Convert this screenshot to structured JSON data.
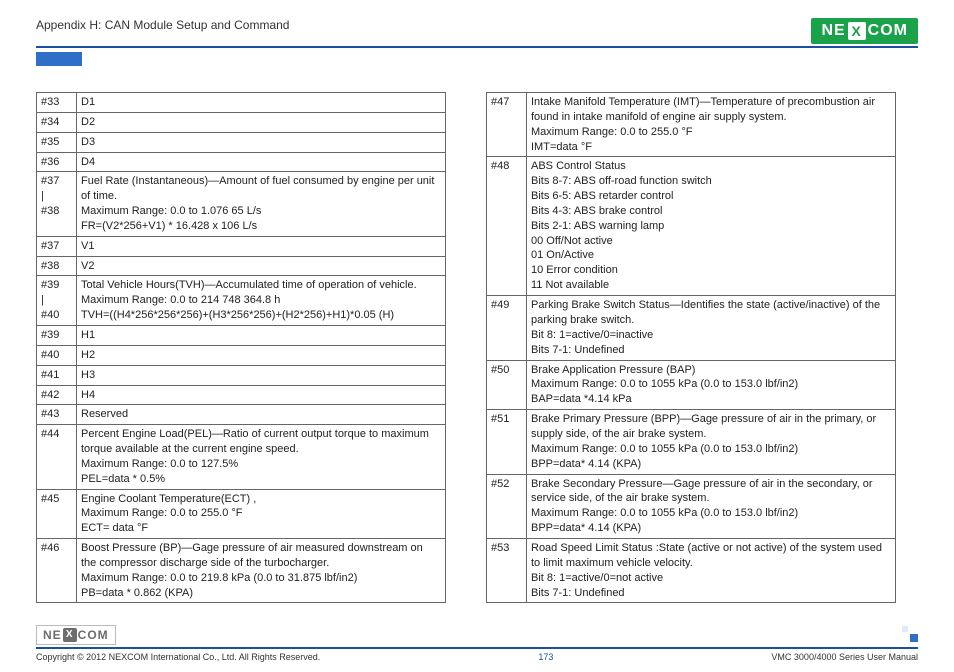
{
  "header": {
    "appendix": "Appendix H: CAN Module Setup and Command",
    "logo_left": "NE",
    "logo_x": "X",
    "logo_right": "COM"
  },
  "left_rows": [
    {
      "idx": "#33",
      "val": "D1"
    },
    {
      "idx": "#34",
      "val": "D2"
    },
    {
      "idx": "#35",
      "val": "D3"
    },
    {
      "idx": "#36",
      "val": "D4"
    },
    {
      "idx": "#37\n|\n#38",
      "val": "Fuel Rate (Instantaneous)—Amount of fuel consumed by engine per unit of time.\nMaximum Range: 0.0 to 1.076 65 L/s\nFR=(V2*256+V1) * 16.428 x 106 L/s"
    },
    {
      "idx": "#37",
      "val": "V1"
    },
    {
      "idx": "#38",
      "val": "V2"
    },
    {
      "idx": "#39\n|\n#40",
      "val": "Total Vehicle Hours(TVH)—Accumulated time of operation of vehicle.\nMaximum Range: 0.0 to 214 748 364.8 h\nTVH=((H4*256*256*256)+(H3*256*256)+(H2*256)+H1)*0.05 (H)"
    },
    {
      "idx": "#39",
      "val": "H1"
    },
    {
      "idx": "#40",
      "val": "H2"
    },
    {
      "idx": "#41",
      "val": "H3"
    },
    {
      "idx": "#42",
      "val": "H4"
    },
    {
      "idx": "#43",
      "val": "Reserved"
    },
    {
      "idx": "#44",
      "val": "Percent Engine Load(PEL)—Ratio of current output torque to maximum torque available at the current engine speed.\nMaximum Range: 0.0 to 127.5%\nPEL=data * 0.5%"
    },
    {
      "idx": "#45",
      "val": "Engine Coolant Temperature(ECT) ,\nMaximum Range: 0.0 to 255.0 °F\nECT= data °F"
    },
    {
      "idx": "#46",
      "val": "Boost Pressure (BP)—Gage pressure of air measured downstream on the compressor discharge side of the turbocharger.\nMaximum Range: 0.0 to 219.8 kPa (0.0 to 31.875 lbf/in2)\nPB=data * 0.862 (KPA)"
    }
  ],
  "right_rows": [
    {
      "idx": "#47",
      "val": "Intake Manifold Temperature (IMT)—Temperature of precombustion air found in intake manifold of engine air supply system.\nMaximum Range: 0.0 to 255.0 °F\nIMT=data °F"
    },
    {
      "idx": "#48",
      "val": "ABS Control Status\nBits 8-7: ABS off-road function switch\nBits 6-5: ABS retarder control\nBits 4-3: ABS brake control\nBits 2-1: ABS warning lamp\n00 Off/Not active\n01 On/Active\n10 Error condition\n11 Not available"
    },
    {
      "idx": "#49",
      "val": "Parking Brake Switch Status—Identifies the state (active/inactive) of the parking brake switch.\nBit 8: 1=active/0=inactive\nBits 7-1: Undefined"
    },
    {
      "idx": "#50",
      "val": "Brake Application Pressure (BAP)\nMaximum Range: 0.0 to 1055 kPa (0.0 to 153.0 lbf/in2)\nBAP=data *4.14 kPa"
    },
    {
      "idx": "#51",
      "val": "Brake Primary Pressure (BPP)—Gage pressure of air in the primary, or supply side, of the air brake system.\nMaximum Range: 0.0 to 1055 kPa (0.0 to 153.0 lbf/in2)\nBPP=data* 4.14 (KPA)"
    },
    {
      "idx": "#52",
      "val": "Brake Secondary Pressure—Gage pressure of air in the secondary, or service side, of the air brake system.\nMaximum Range: 0.0 to 1055 kPa (0.0 to 153.0 lbf/in2)\nBPP=data* 4.14 (KPA)"
    },
    {
      "idx": "#53",
      "val": "Road Speed Limit Status :State (active or not active) of the system used to limit maximum vehicle velocity.\nBit 8: 1=active/0=not active\nBits 7-1: Undefined"
    }
  ],
  "footer": {
    "copyright": "Copyright © 2012 NEXCOM International Co., Ltd. All Rights Reserved.",
    "page": "173",
    "doc": "VMC 3000/4000 Series User Manual"
  }
}
